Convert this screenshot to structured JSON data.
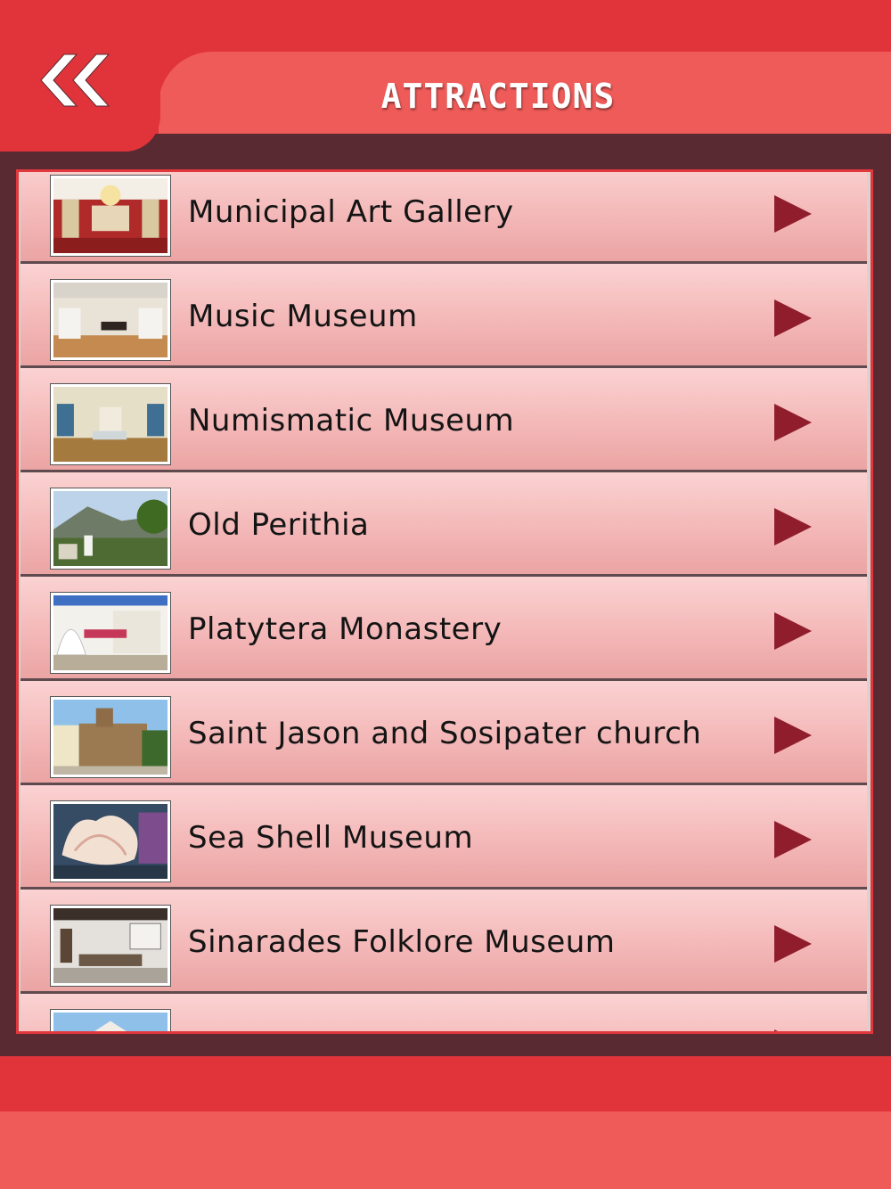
{
  "header": {
    "title": "ATTRACTIONS",
    "back_icon": "double-chevron-left-icon"
  },
  "colors": {
    "header_red": "#e1343a",
    "tab_red": "#ef5b59",
    "frame_dark": "#5a2a33",
    "row_pink": "#f4b8b8",
    "arrow": "#8f1d2c"
  },
  "attractions": [
    {
      "label": "Municipal Art Gallery",
      "thumb": "gallery-hall-photo"
    },
    {
      "label": "Music Museum",
      "thumb": "museum-room-photo"
    },
    {
      "label": "Numismatic Museum",
      "thumb": "museum-corridor-photo"
    },
    {
      "label": "Old Perithia",
      "thumb": "mountain-village-photo"
    },
    {
      "label": "Platytera Monastery",
      "thumb": "monastery-courtyard-photo"
    },
    {
      "label": "Saint Jason and Sosipater church",
      "thumb": "stone-church-photo"
    },
    {
      "label": "Sea Shell Museum",
      "thumb": "sea-shell-photo"
    },
    {
      "label": "Sinarades Folklore Museum",
      "thumb": "folklore-room-photo"
    },
    {
      "label": "",
      "thumb": "building-photo"
    }
  ]
}
